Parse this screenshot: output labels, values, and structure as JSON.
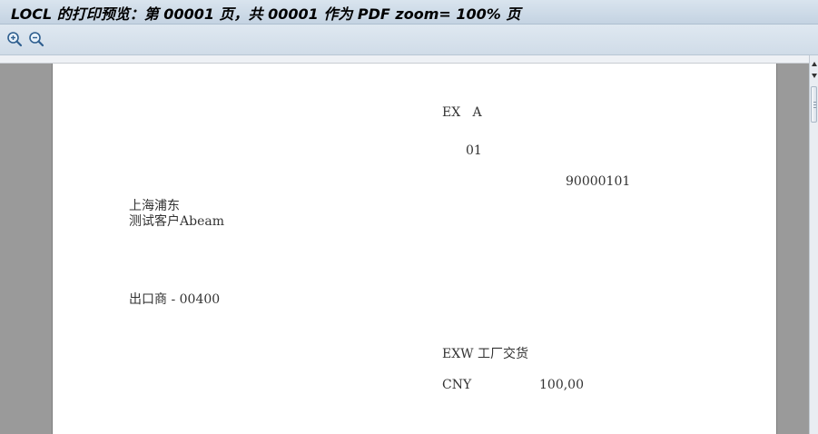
{
  "window": {
    "title": "LOCL 的打印预览：第 00001 页，共 00001 作为 PDF zoom= 100% 页"
  },
  "toolbar": {
    "buttons": [
      {
        "name": "zoom-in",
        "icon": "zoom-in-icon"
      },
      {
        "name": "zoom-out",
        "icon": "zoom-out-icon"
      }
    ]
  },
  "document": {
    "header_line1": "EX   A",
    "header_line2": "01",
    "doc_number": "90000101",
    "address_city": "上海浦东",
    "customer_name": "测试客户Abeam",
    "exporter": "出口商 - 00400",
    "incoterms": "EXW 工厂交货",
    "currency": "CNY",
    "amount": "100,00"
  },
  "colors": {
    "titlebar": "#c4d3e2",
    "toolbar": "#d0dce8",
    "canvas": "#9a9a9a",
    "page": "#ffffff"
  }
}
